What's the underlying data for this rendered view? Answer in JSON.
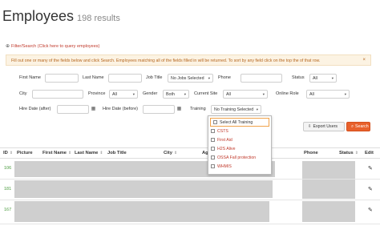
{
  "header": {
    "title": "Employees",
    "count": "198 results"
  },
  "filter_toggle": {
    "icon": "plus-icon",
    "label": "Filter/Search (Click here to query employees)"
  },
  "info_banner": {
    "text": "Fill out one or many of the fields below and click Search. Employees matching all of the fields filled in will be returned. To sort by any field click on the top the of that row.",
    "close": "×"
  },
  "form": {
    "first_name": "First Name",
    "last_name": "Last Name",
    "job_title": "Job Title",
    "job_title_value": "No Jobs Selected",
    "phone": "Phone",
    "status": "Status",
    "status_value": "All",
    "city": "City",
    "province": "Province",
    "province_value": "All",
    "gender": "Gender",
    "gender_value": "Both",
    "current_site": "Current Site",
    "current_site_value": "All",
    "online_role": "Online Role",
    "online_role_value": "All",
    "hire_date_after": "Hire Date (after)",
    "hire_date_before": "Hire Date (before)",
    "training": "Training",
    "training_value": "No Training Selected"
  },
  "training_options": [
    "Select All Training",
    "CSTS",
    "First Aid",
    "H2S Alive",
    "OSSA Fall protection",
    "WHMIS"
  ],
  "buttons": {
    "export": "Export Users",
    "search": "Search"
  },
  "table": {
    "columns": [
      "ID",
      "Picture",
      "First Name",
      "Last Name",
      "Job Title",
      "City",
      "Age",
      "Phone",
      "Status",
      "Edit"
    ],
    "rows": [
      {
        "id": "106"
      },
      {
        "id": "181"
      },
      {
        "id": "167"
      }
    ]
  },
  "colors": {
    "accent": "#e8612c",
    "link": "#c0392b",
    "id_green": "#4a9b3e",
    "banner_bg": "#fcf3e3"
  }
}
